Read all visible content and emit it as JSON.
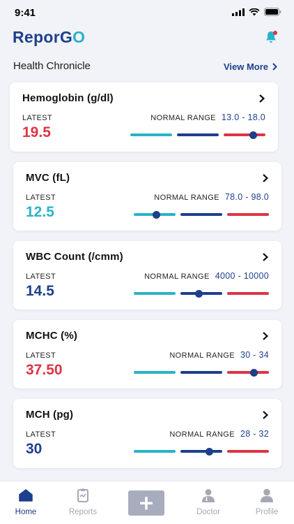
{
  "status": {
    "time": "9:41"
  },
  "app": {
    "logo_text": "ReporG",
    "logo_accent": "O",
    "brand_color": "#1e3f8c",
    "accent_color": "#2ab3c8"
  },
  "section": {
    "title": "Health Chronicle",
    "view_more": "View More"
  },
  "latest_label": "LATEST",
  "normal_range_label": "NORMAL RANGE",
  "colors": {
    "low": "#2ab3c8",
    "normal": "#1e3f8c",
    "high": "#dc3545"
  },
  "cards": [
    {
      "title": "Hemoglobin (g/dl)",
      "latest": "19.5",
      "status": "high",
      "range": "13.0 - 18.0",
      "marker_fraction": 0.91
    },
    {
      "title": "MVC (fL)",
      "latest": "12.5",
      "status": "low",
      "range": "78.0 - 98.0",
      "marker_fraction": 0.17
    },
    {
      "title": "WBC Count (/cmm)",
      "latest": "14.5",
      "status": "normal",
      "range": "4000 - 10000",
      "marker_fraction": 0.48
    },
    {
      "title": "MCHC (%)",
      "latest": "37.50",
      "status": "high",
      "range": "30 - 34",
      "marker_fraction": 0.89
    },
    {
      "title": "MCH (pg)",
      "latest": "30",
      "status": "normal",
      "range": "28 - 32",
      "marker_fraction": 0.56
    }
  ],
  "tabs": [
    {
      "label": "Home",
      "icon": "home-icon",
      "active": true
    },
    {
      "label": "Reports",
      "icon": "reports-icon",
      "active": false
    },
    {
      "label": "",
      "icon": "plus-icon",
      "active": false
    },
    {
      "label": "Doctor",
      "icon": "doctor-icon",
      "active": false
    },
    {
      "label": "Profile",
      "icon": "profile-icon",
      "active": false
    }
  ]
}
